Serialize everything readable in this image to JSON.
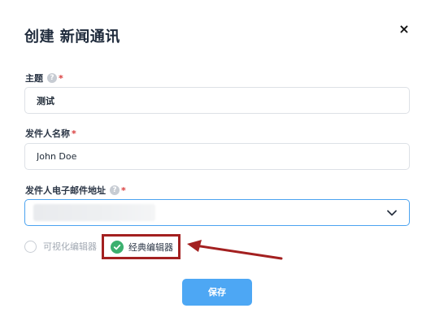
{
  "dialog": {
    "title": "创建 新闻通讯",
    "close_label": "×"
  },
  "fields": {
    "subject": {
      "label": "主题",
      "required_mark": "*",
      "help": "?",
      "value": "测试"
    },
    "sender_name": {
      "label": "发件人名称",
      "required_mark": "*",
      "value": "John Doe"
    },
    "sender_email": {
      "label": "发件人电子邮件地址",
      "required_mark": "*",
      "help": "?",
      "value": ""
    }
  },
  "editor_mode": {
    "options": [
      {
        "label": "可视化编辑器",
        "selected": false
      },
      {
        "label": "经典编辑器",
        "selected": true
      }
    ]
  },
  "actions": {
    "save_label": "保存"
  },
  "colors": {
    "accent": "#4da7f4",
    "focus_border": "#4ba3f0",
    "selected_radio": "#3cb06f",
    "annotation": "#a32020",
    "required": "#d93c3c"
  }
}
